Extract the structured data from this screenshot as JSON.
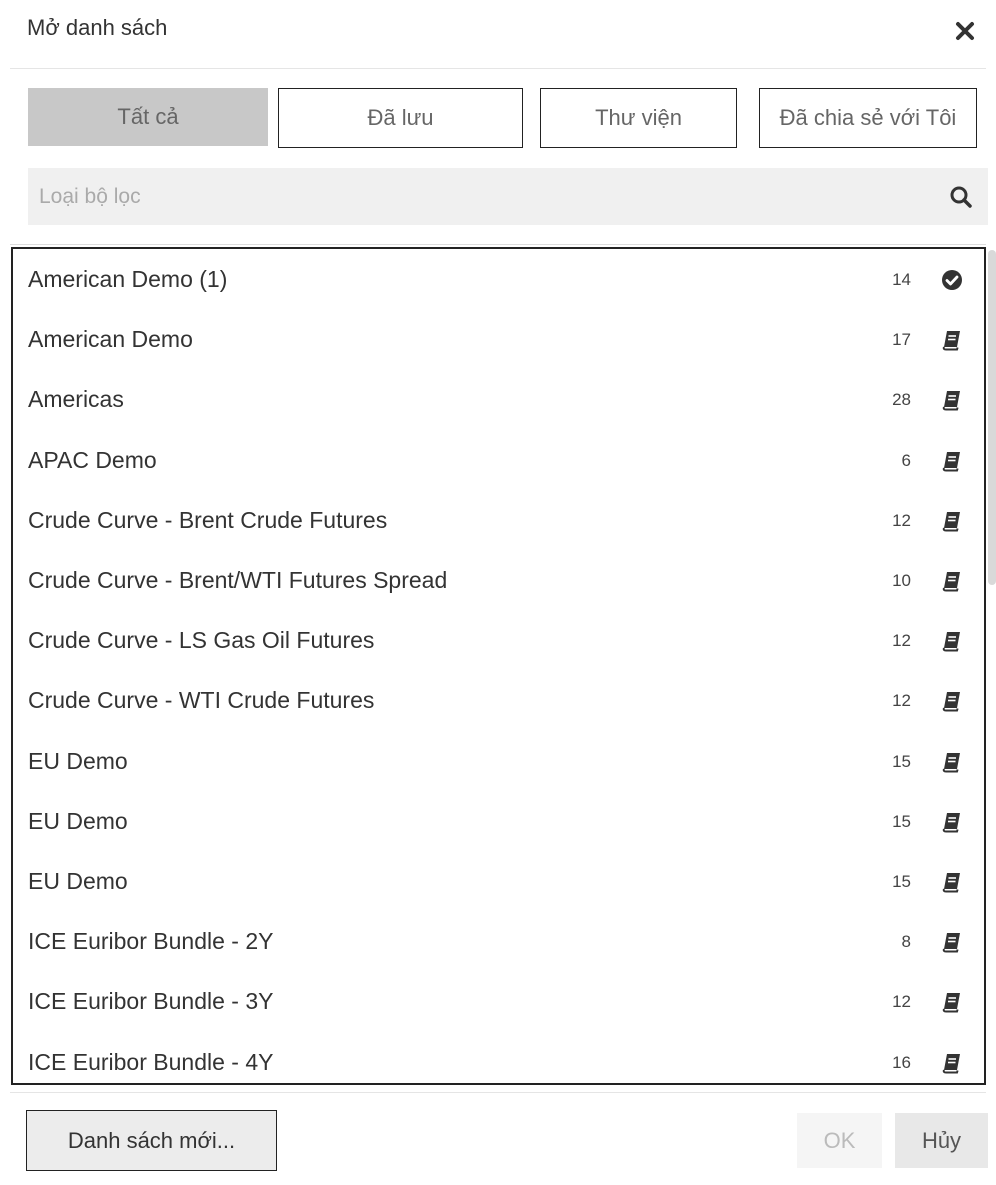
{
  "dialog": {
    "title": "Mở danh sách",
    "close_icon": "close-icon"
  },
  "tabs": [
    {
      "label": "Tất cả",
      "active": true
    },
    {
      "label": "Đã lưu",
      "active": false
    },
    {
      "label": "Thư viện",
      "active": false
    },
    {
      "label": "Đã chia sẻ với Tôi",
      "active": false
    }
  ],
  "search": {
    "placeholder": "Loại bộ lọc",
    "value": "",
    "icon": "search-icon"
  },
  "lists": [
    {
      "name": "American Demo (1)",
      "count": "14",
      "icon": "check-circle-icon"
    },
    {
      "name": "American Demo",
      "count": "17",
      "icon": "book-icon"
    },
    {
      "name": "Americas",
      "count": "28",
      "icon": "book-icon"
    },
    {
      "name": "APAC Demo",
      "count": "6",
      "icon": "book-icon"
    },
    {
      "name": "Crude Curve - Brent Crude Futures",
      "count": "12",
      "icon": "book-icon"
    },
    {
      "name": "Crude Curve - Brent/WTI Futures Spread",
      "count": "10",
      "icon": "book-icon"
    },
    {
      "name": "Crude Curve - LS Gas Oil Futures",
      "count": "12",
      "icon": "book-icon"
    },
    {
      "name": "Crude Curve - WTI Crude Futures",
      "count": "12",
      "icon": "book-icon"
    },
    {
      "name": "EU Demo",
      "count": "15",
      "icon": "book-icon"
    },
    {
      "name": "EU Demo",
      "count": "15",
      "icon": "book-icon"
    },
    {
      "name": "EU Demo",
      "count": "15",
      "icon": "book-icon"
    },
    {
      "name": "ICE Euribor Bundle - 2Y",
      "count": "8",
      "icon": "book-icon"
    },
    {
      "name": "ICE Euribor Bundle - 3Y",
      "count": "12",
      "icon": "book-icon"
    },
    {
      "name": "ICE Euribor Bundle - 4Y",
      "count": "16",
      "icon": "book-icon"
    }
  ],
  "footer": {
    "new_list_label": "Danh sách mới...",
    "ok_label": "OK",
    "cancel_label": "Hủy"
  }
}
